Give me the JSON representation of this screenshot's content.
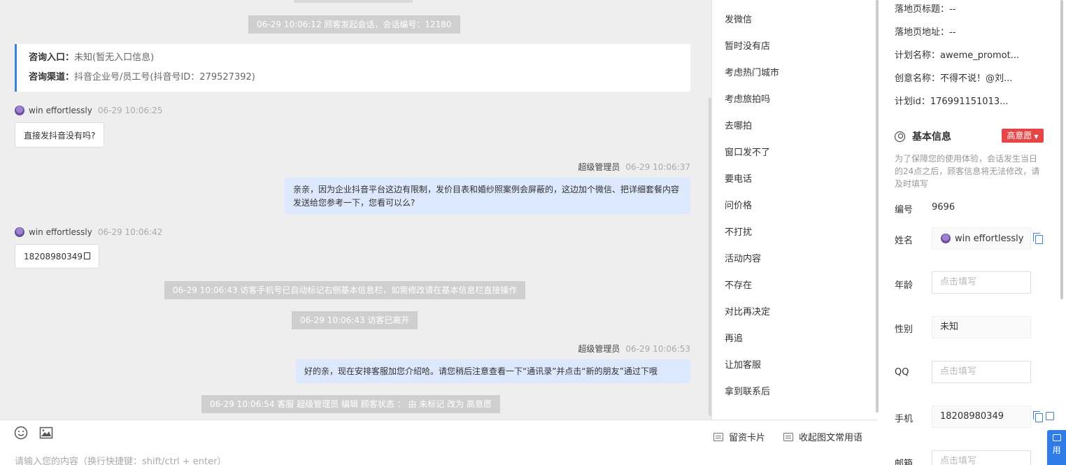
{
  "chat": {
    "system_messages": {
      "session_start": "06-29 10:06:12 顾客发起会话，会话编号：12180",
      "phone_marked": "06-29 10:06:43 访客手机号已自动标记右侧基本信息栏，如需修改请在基本信息栏直接操作",
      "visitor_left": "06-29 10:06:43 访客已离开",
      "status_edit": "06-29 10:06:54 客服 超级管理员 编辑 顾客状态 ： 由 未标记 改为 高意愿"
    },
    "info_card": {
      "entry_label": "咨询入口：",
      "entry_value": "未知(暂无入口信息)",
      "channel_label": "咨询渠道：",
      "channel_value": "抖音企业号/员工号(抖音号ID：279527392)"
    },
    "messages": [
      {
        "sender": "win effortlessly",
        "time": "06-29 10:06:25",
        "text": "直接发抖音没有吗?"
      },
      {
        "sender": "超级管理员",
        "time": "06-29 10:06:37",
        "text": "亲亲，因为企业抖音平台这边有限制，发价目表和婚纱照案例会屏蔽的，这边加个微信、把详细套餐内容发送给您参考一下，您看可以么?"
      },
      {
        "sender": "win effortlessly",
        "time": "06-29 10:06:42",
        "text": "18208980349"
      },
      {
        "sender": "超级管理员",
        "time": "06-29 10:06:53",
        "text": "好的亲，现在安排客服加您介绍哈。请您稍后注意查看一下“通讯录”并点击“新的朋友”通过下哦"
      }
    ]
  },
  "input": {
    "placeholder": "请输入您的内容（换行快捷键：shift/ctrl + enter）",
    "card_button": "留资卡片",
    "phrases_button": "收起图文常用语"
  },
  "quick_replies": [
    "发微信",
    "暂时没有店",
    "考虑热门城市",
    "考虑旅拍吗",
    "去哪拍",
    "窗口发不了",
    "要电话",
    "问价格",
    "不打扰",
    "活动内容",
    "不存在",
    "对比再决定",
    "再追",
    "让加客服",
    "拿到联系后"
  ],
  "panel": {
    "landing_title": "落地页标题：--",
    "landing_url": "落地页地址：--",
    "plan_name": "计划名称：aweme_promot...",
    "creative_name": "创意名称：不得不说！@刘...",
    "plan_id": "计划id：176991151013...",
    "section_title": "基本信息",
    "intent_badge": "高意愿",
    "notice": "为了保障您的使用体验，会话发生当日的24点之后，顾客信息将无法修改，请及时填写",
    "fields": {
      "id_label": "编号",
      "id_value": "9696",
      "name_label": "姓名",
      "name_value": "win effortlessly",
      "age_label": "年龄",
      "age_placeholder": "点击填写",
      "gender_label": "性别",
      "gender_value": "未知",
      "qq_label": "QQ",
      "qq_placeholder": "点击填写",
      "phone_label": "手机",
      "phone_value": "18208980349",
      "email_label": "邮箱",
      "email_placeholder": "点击填写"
    },
    "float_button": "用"
  },
  "colors": {
    "accent": "#3b7fe0",
    "badge_red": "#e64545",
    "outgoing_bubble": "#dbe8fd",
    "system_gray": "#cfcfcf"
  }
}
